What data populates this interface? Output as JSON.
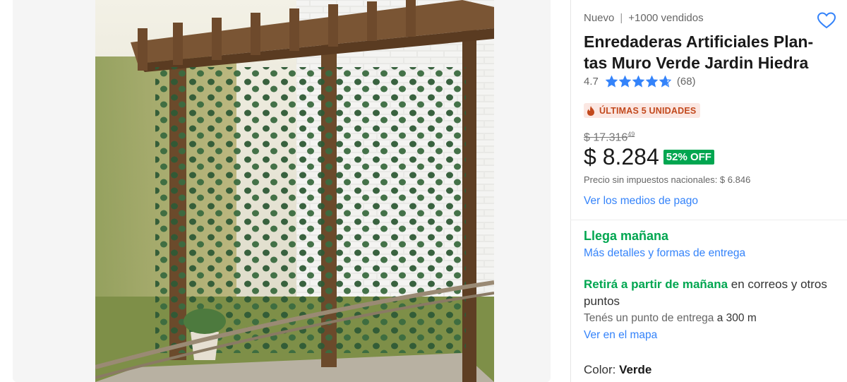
{
  "product": {
    "condition": "Nuevo",
    "sold": "+1000 vendidos",
    "title": "Enredaderas Artificiales Plan-tas Muro Verde Jardin Hiedra",
    "rating": "4.7",
    "stars_value": 4.7,
    "reviews": "(68)",
    "stock_badge": "ÚLTIMAS 5 UNIDADES",
    "old_price": "$ 17.316",
    "old_price_cents": "49",
    "price": "$ 8.284",
    "discount": "52% OFF",
    "tax_note": "Precio sin impuestos nacionales: $ 6.846",
    "payment_link": "Ver los medios de pago"
  },
  "shipping": {
    "arrival": "Llega mañana",
    "details_link": "Más detalles y formas de entrega",
    "pickup_green": "Retirá a partir de mañana",
    "pickup_rest": " en correos y otros puntos",
    "point_text": "Tenés un punto de entrega ",
    "point_distance": "a 300 m",
    "map_link": "Ver en el mapa"
  },
  "variant": {
    "label": "Color: ",
    "value": "Verde"
  },
  "colors": {
    "link": "#3483fa",
    "green": "#00a650",
    "badge_bg": "#fbe7e2",
    "badge_text": "#c2491d",
    "star": "#3483fa"
  },
  "icons": {
    "favorite": "heart-icon",
    "star": "star-icon",
    "badge": "flame-icon"
  }
}
